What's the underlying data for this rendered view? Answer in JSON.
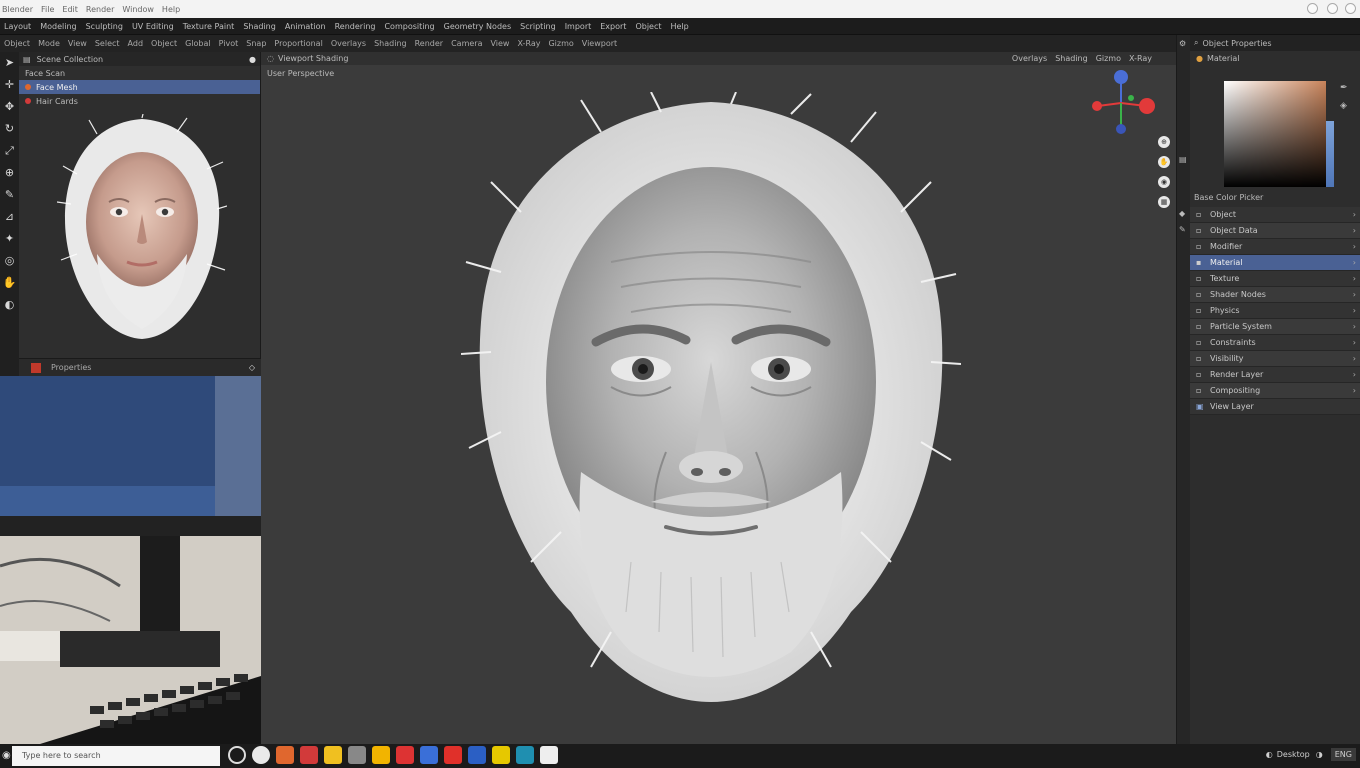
{
  "window": {
    "title_items": [
      "Blender",
      "File",
      "Edit",
      "Render",
      "Window",
      "Help"
    ]
  },
  "menubar": {
    "items": [
      "Layout",
      "Modeling",
      "Sculpting",
      "UV Editing",
      "Texture Paint",
      "Shading",
      "Animation",
      "Rendering",
      "Compositing",
      "Geometry Nodes",
      "Scripting",
      "Import",
      "Export",
      "Object",
      "Help"
    ]
  },
  "toolbar": {
    "items": [
      "Object",
      "Mode",
      "View",
      "Select",
      "Add",
      "Object",
      "Global",
      "Pivot",
      "Snap",
      "Proportional",
      "Overlays",
      "Shading",
      "Render",
      "Camera",
      "View",
      "X-Ray",
      "Gizmo",
      "Viewport"
    ]
  },
  "outliner": {
    "header": "Scene Collection",
    "rows": [
      {
        "label": "Face Scan",
        "selected": false
      },
      {
        "label": "Face Mesh",
        "selected": true
      },
      {
        "label": "Hair Cards",
        "selected": false
      }
    ],
    "footer": "Properties"
  },
  "viewport": {
    "header": "Viewport Shading",
    "sub": "User Perspective",
    "icons": [
      "Overlays",
      "Shading",
      "Gizmo",
      "X-Ray"
    ],
    "nav": [
      "Zoom",
      "Pan",
      "Camera",
      "Persp"
    ]
  },
  "properties": {
    "header": "Object Properties",
    "sub": "Material",
    "color_label": "Base Color Picker",
    "items": [
      {
        "label": "Object",
        "icon": "▪",
        "state": "normal"
      },
      {
        "label": "Object Data",
        "icon": "▪",
        "state": "alt"
      },
      {
        "label": "Modifier",
        "icon": "▪",
        "state": "normal"
      },
      {
        "label": "Material",
        "icon": "▪",
        "state": "sel"
      },
      {
        "label": "Texture",
        "icon": "▪",
        "state": "normal"
      },
      {
        "label": "Shader Nodes",
        "icon": "▪",
        "state": "alt"
      },
      {
        "label": "Physics",
        "icon": "▪",
        "state": "normal"
      },
      {
        "label": "Particle System",
        "icon": "▪",
        "state": "alt"
      },
      {
        "label": "Constraints",
        "icon": "▪",
        "state": "normal"
      },
      {
        "label": "Visibility",
        "icon": "▪",
        "state": "alt"
      },
      {
        "label": "Render Layer",
        "icon": "▪",
        "state": "normal"
      },
      {
        "label": "Compositing",
        "icon": "▪",
        "state": "alt"
      },
      {
        "label": "View Layer",
        "icon": "▪",
        "state": "normal"
      }
    ]
  },
  "taskbar": {
    "search": "Type here to search",
    "tray": "Desktop",
    "clock": "ENG"
  },
  "colors": {
    "accent": "#4a6194",
    "gizmo_x": "#e23a3a",
    "gizmo_y": "#3ab34a",
    "gizmo_z": "#4a6ed6"
  }
}
